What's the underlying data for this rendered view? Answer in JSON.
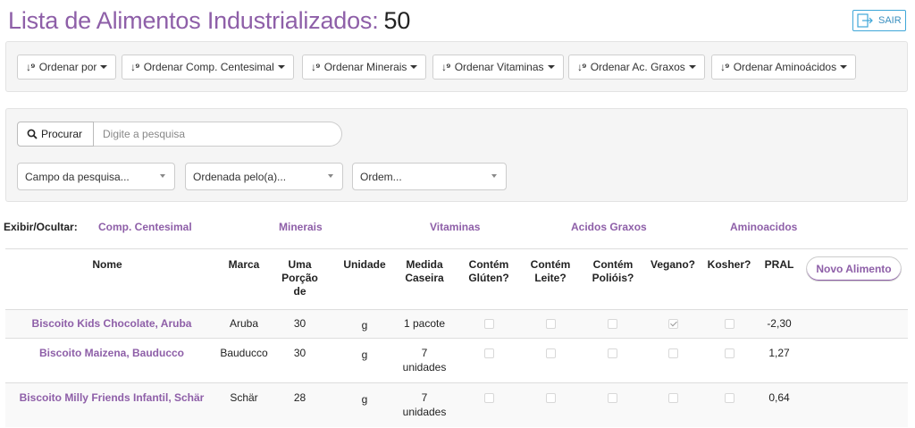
{
  "page": {
    "title": "Lista de Alimentos Industrializados:",
    "count": "50",
    "logout_label": "SAIR"
  },
  "sort_buttons": [
    {
      "icon": "sort-icon",
      "label": "Ordenar por"
    },
    {
      "icon": "sort-icon",
      "label": "Ordenar Comp. Centesimal"
    },
    {
      "icon": "sort-icon",
      "label": "Ordenar Minerais"
    },
    {
      "icon": "sort-icon",
      "label": "Ordenar Vitaminas"
    },
    {
      "icon": "sort-icon",
      "label": "Ordenar Ac. Graxos"
    },
    {
      "icon": "sort-icon",
      "label": "Ordenar Aminoácidos"
    }
  ],
  "search": {
    "button_label": "Procurar",
    "placeholder": "Digite a pesquisa",
    "field_select": "Campo da pesquisa...",
    "orderby_select": "Ordenada pelo(a)...",
    "order_select": "Ordem..."
  },
  "toggles": {
    "label": "Exibir/Ocultar:",
    "items": [
      "Comp. Centesimal",
      "Minerais",
      "Vitaminas",
      "Acidos Graxos",
      "Aminoacidos"
    ]
  },
  "table": {
    "headers": {
      "nome": "Nome",
      "marca": "Marca",
      "porcao": [
        "Uma",
        "Porção",
        "de"
      ],
      "unidade": "Unidade",
      "medida": [
        "Medida",
        "Caseira"
      ],
      "gluten": [
        "Contém",
        "Glúten?"
      ],
      "leite": [
        "Contém",
        "Leite?"
      ],
      "poliois": [
        "Contém",
        "Polióis?"
      ],
      "vegano": "Vegano?",
      "kosher": "Kosher?",
      "pral": "PRAL"
    },
    "new_button": "Novo Alimento",
    "rows": [
      {
        "nome": "Biscoito Kids Chocolate, Aruba",
        "marca": "Aruba",
        "porcao": "30",
        "unidade": "g",
        "medida": [
          "1 pacote",
          ""
        ],
        "gluten": false,
        "leite": false,
        "poliois": false,
        "vegano": true,
        "kosher": false,
        "pral": "-2,30"
      },
      {
        "nome": "Biscoito Maizena, Bauducco",
        "marca": "Bauducco",
        "porcao": "30",
        "unidade": "g",
        "medida": [
          "7",
          "unidades"
        ],
        "gluten": false,
        "leite": false,
        "poliois": false,
        "vegano": false,
        "kosher": false,
        "pral": "1,27"
      },
      {
        "nome": "Biscoito Milly Friends Infantil, Schär",
        "marca": "Schär",
        "porcao": "28",
        "unidade": "g",
        "medida": [
          "7",
          "unidades"
        ],
        "gluten": false,
        "leite": false,
        "poliois": false,
        "vegano": false,
        "kosher": false,
        "pral": "0,64"
      }
    ]
  },
  "colors": {
    "accent": "#8e5fa8",
    "logout_border": "#3fa7d8"
  }
}
